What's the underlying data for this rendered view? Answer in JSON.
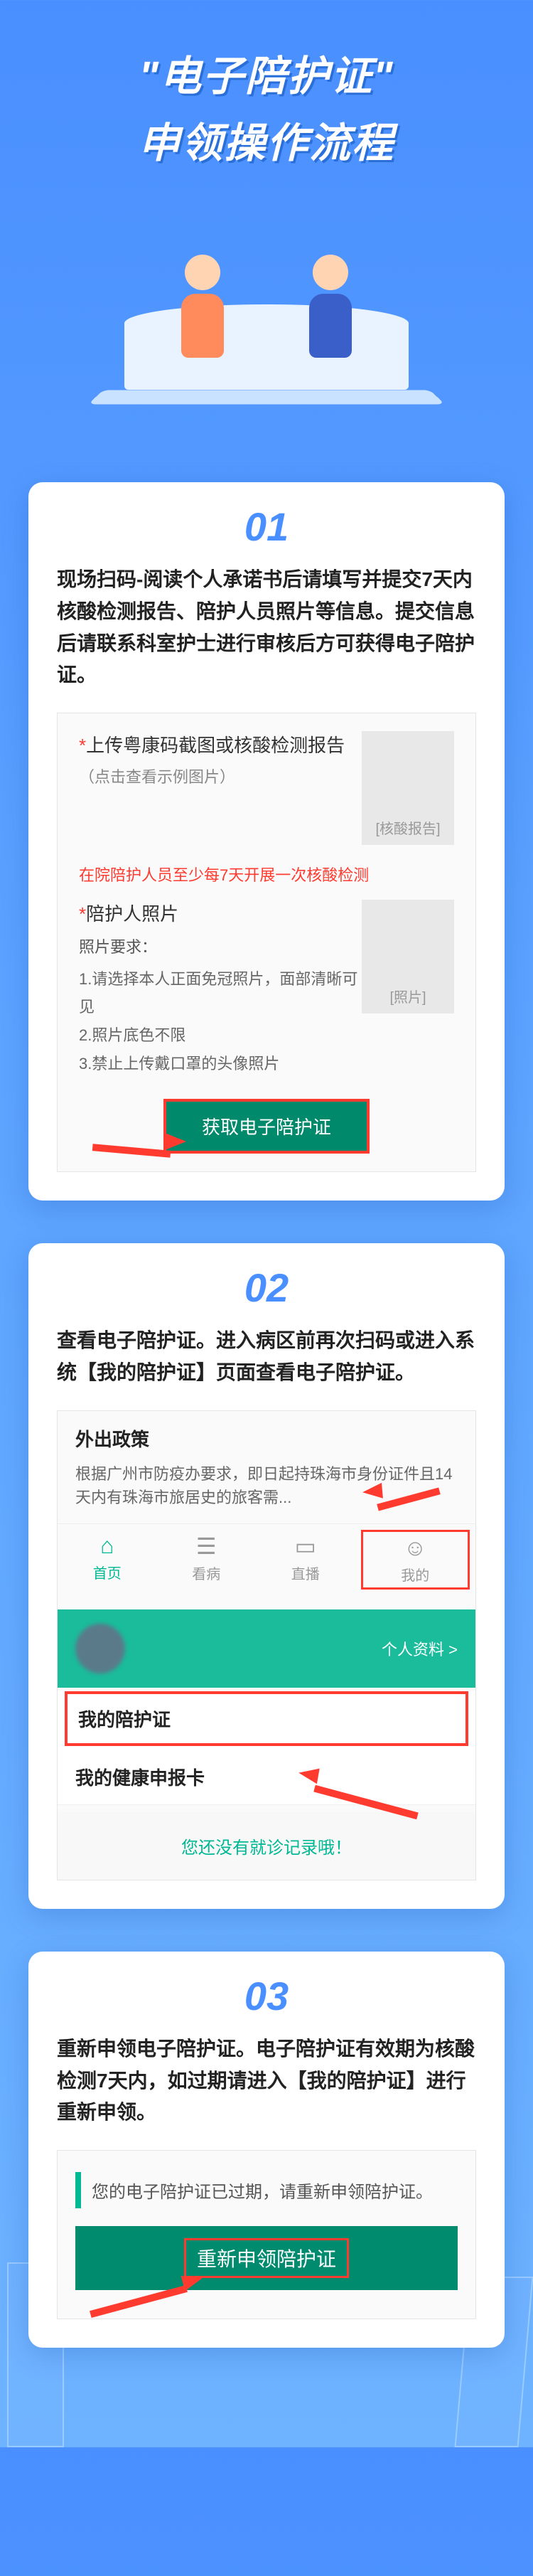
{
  "header": {
    "title_line1": "\"电子陪护证\"",
    "title_line2": "申领操作流程"
  },
  "step1": {
    "number": "01",
    "desc": "现场扫码-阅读个人承诺书后请填写并提交7天内核酸检测报告、陪护人员照片等信息。提交信息后请联系科室护士进行审核后方可获得电子陪护证。",
    "screenshot": {
      "upload1_label": "上传粤康码截图或核酸检测报告",
      "upload1_hint": "（点击查看示例图片）",
      "upload1_placeholder": "[核酸报告]",
      "warning": "在院陪护人员至少每7天开展一次核酸检测",
      "upload2_label": "陪护人照片",
      "photo_req_title": "照片要求：",
      "photo_req_1": "1.请选择本人正面免冠照片，面部清晰可见",
      "photo_req_2": "2.照片底色不限",
      "photo_req_3": "3.禁止上传戴口罩的头像照片",
      "upload2_placeholder": "[照片]",
      "button": "获取电子陪护证"
    }
  },
  "step2": {
    "number": "02",
    "desc": "查看电子陪护证。进入病区前再次扫码或进入系统【我的陪护证】页面查看电子陪护证。",
    "screenshot": {
      "policy_title": "外出政策",
      "policy_text": "根据广州市防疫办要求，即日起持珠海市身份证件且14天内有珠海市旅居史的旅客需...",
      "nav": {
        "home": "首页",
        "consult": "看病",
        "live": "直播",
        "mine": "我的"
      },
      "profile_link": "个人资料 >",
      "menu_care": "我的陪护证",
      "menu_health": "我的健康申报卡",
      "empty": "您还没有就诊记录哦！"
    }
  },
  "step3": {
    "number": "03",
    "desc": "重新申领电子陪护证。电子陪护证有效期为核酸检测7天内，如过期请进入【我的陪护证】进行重新申领。",
    "screenshot": {
      "expired": "您的电子陪护证已过期，请重新申领陪护证。",
      "button": "重新申领陪护证"
    }
  }
}
